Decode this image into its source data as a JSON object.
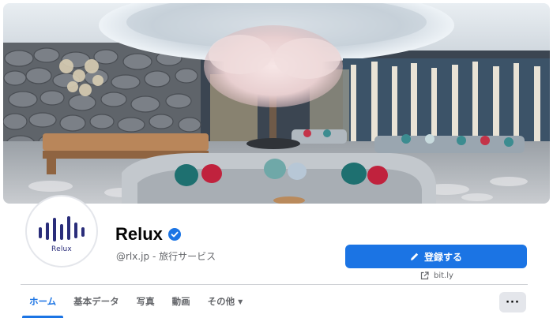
{
  "page": {
    "name": "Relux",
    "handle": "@rlx.jp - 旅行サービス",
    "verified_icon": "verified-badge-icon",
    "avatar_text": "Relux"
  },
  "actions": {
    "primary_label": "登録する",
    "primary_icon": "pencil-icon",
    "link_text": "bit.ly",
    "link_icon": "external-link-icon",
    "more_label": "···"
  },
  "tabs": [
    {
      "label": "ホーム",
      "active": true
    },
    {
      "label": "基本データ",
      "active": false
    },
    {
      "label": "写真",
      "active": false
    },
    {
      "label": "動画",
      "active": false
    },
    {
      "label": "その他",
      "active": false,
      "has_caret": true
    }
  ],
  "colors": {
    "accent": "#1b74e4",
    "logo": "#2a2d7a",
    "secondary_text": "#65676b"
  }
}
